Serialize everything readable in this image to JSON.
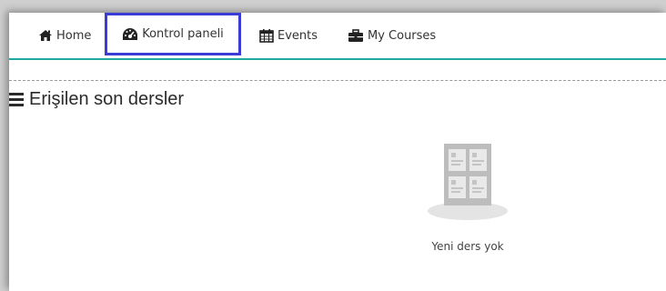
{
  "nav": {
    "items": [
      {
        "label": "Home",
        "icon": "home-icon"
      },
      {
        "label": "Kontrol paneli",
        "icon": "dashboard-icon"
      },
      {
        "label": "Events",
        "icon": "calendar-icon"
      },
      {
        "label": "My Courses",
        "icon": "briefcase-icon"
      }
    ],
    "accent_color": "#21a8a0",
    "highlight_color": "#3b3bd6"
  },
  "recent_courses": {
    "title": "Erişilen son dersler",
    "empty_message": "Yeni ders yok",
    "illustration": "course-grid-icon"
  }
}
